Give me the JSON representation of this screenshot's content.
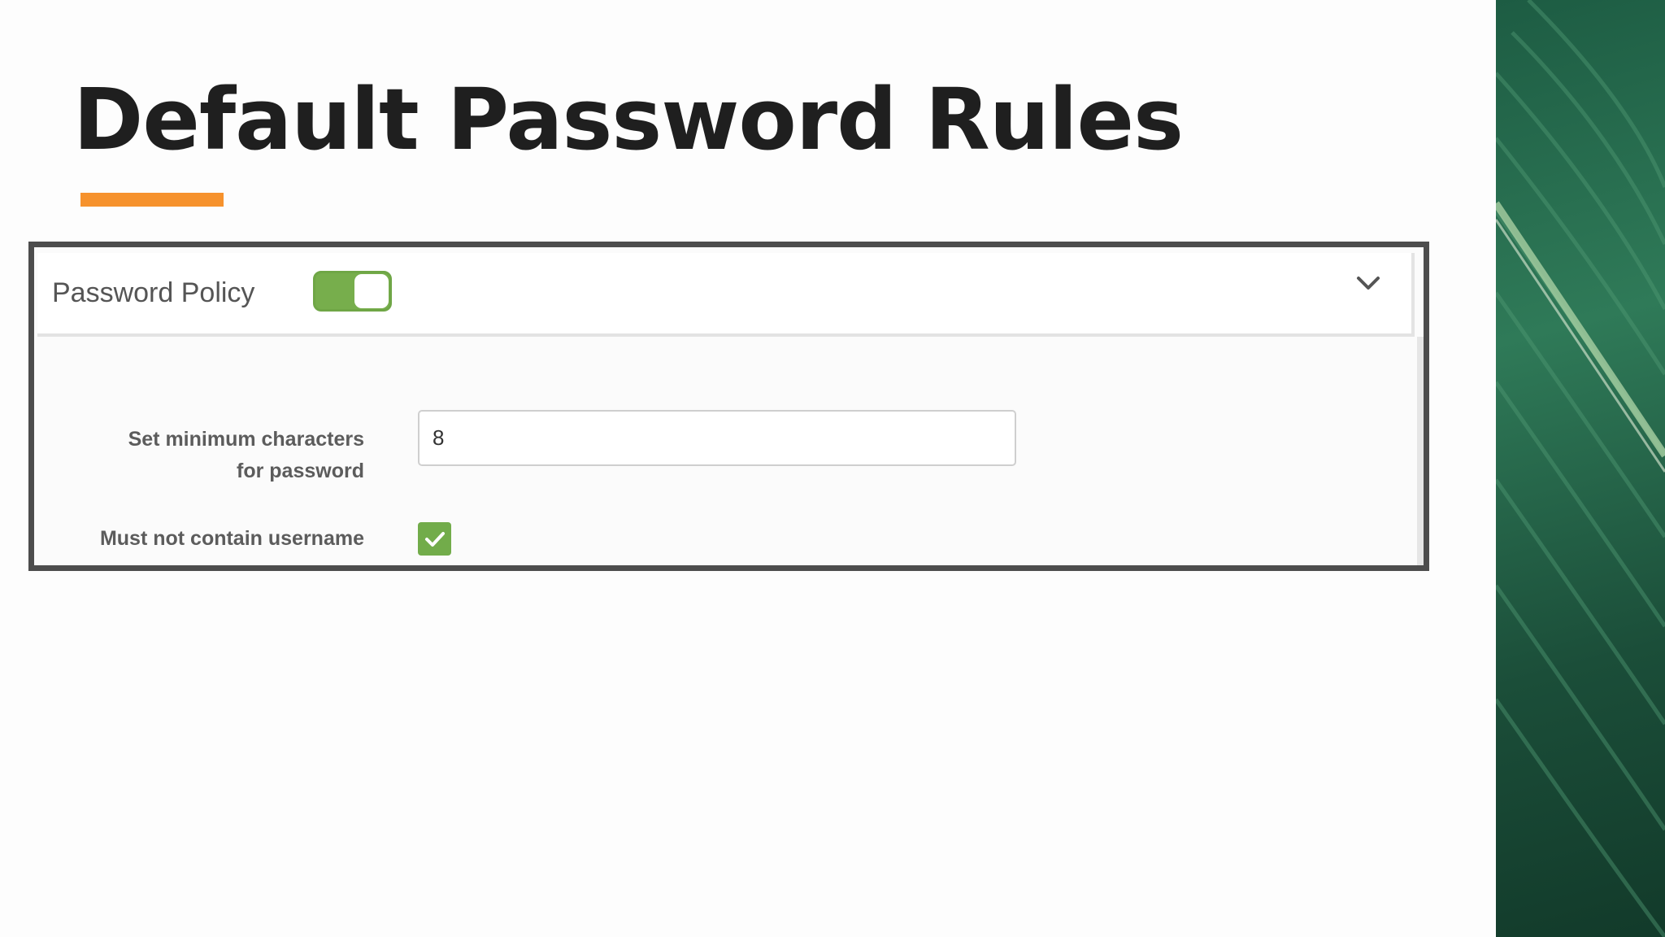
{
  "slide": {
    "title": "Default Password Rules",
    "accent_color": "#f6922d"
  },
  "panel": {
    "title": "Password Policy",
    "toggle_on": true,
    "toggle_color": "#77ae4c",
    "expand_icon": "chevron-down-icon"
  },
  "fields": {
    "min_chars_label_line1": "Set minimum characters",
    "min_chars_label_line2": "for password",
    "min_chars_value": "8",
    "username_label": "Must not contain username",
    "username_checked": true,
    "checkbox_icon": "check-icon"
  },
  "decor": {
    "side_image": "tropical-leaf-image"
  }
}
